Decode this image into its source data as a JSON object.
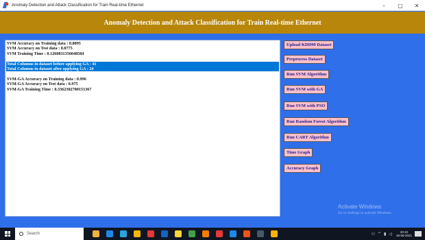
{
  "window": {
    "title": "Anomaly Detection and Attack Classification for Train Real-time Ethernet",
    "controls": [
      "–",
      "▢",
      "✕"
    ]
  },
  "banner": "Anomaly Detection and Attack Classification for Train Real-time Ethernet",
  "output_lines": [
    {
      "text": "SVM Accuracy on Training data : 0.8895",
      "selected": false
    },
    {
      "text": "SVM Accuracy on Test data : 0.8775",
      "selected": false
    },
    {
      "text": "SVM Training Time : 0.1260831356048584",
      "selected": false
    },
    {
      "text": "",
      "selected": false
    },
    {
      "text": "Total Columns in dataset before applying GA : 41",
      "selected": true
    },
    {
      "text": "Total Columns in dataset after applying GA : 24",
      "selected": true
    },
    {
      "text": "",
      "selected": false
    },
    {
      "text": "SVM-GA Accuracy on Training data : 0.996",
      "selected": false
    },
    {
      "text": "SVM-GA Accuracy on Test data : 0.975",
      "selected": false
    },
    {
      "text": "SVM-GA Training Time : 0.3362302780151367",
      "selected": false
    }
  ],
  "buttons": [
    "Upload KDD99 Dataset",
    "Preprocess Dataset",
    "Run SVM Algorithm",
    "Run SVM with GA",
    "Run SVM with PSO",
    "Run Random Forest Algorithm",
    "Run CART Algorithm",
    "Time Graph",
    "Accuracy Graph"
  ],
  "watermark": {
    "title": "Activate Windows",
    "subtitle": "Go to Settings to activate Windows."
  },
  "taskbar": {
    "search_placeholder": "Search",
    "icon_colors": [
      "#f3b13d",
      "#1e88e5",
      "#2aa3e0",
      "#f2b705",
      "#e53935",
      "#1565c0",
      "#fdd835",
      "#43a047",
      "#f57c00",
      "#e53935",
      "#1e88e5",
      "#f4511e",
      "#455a64",
      "#ffb300"
    ],
    "clock_time": "20:22",
    "clock_date": "26-05-2021"
  }
}
